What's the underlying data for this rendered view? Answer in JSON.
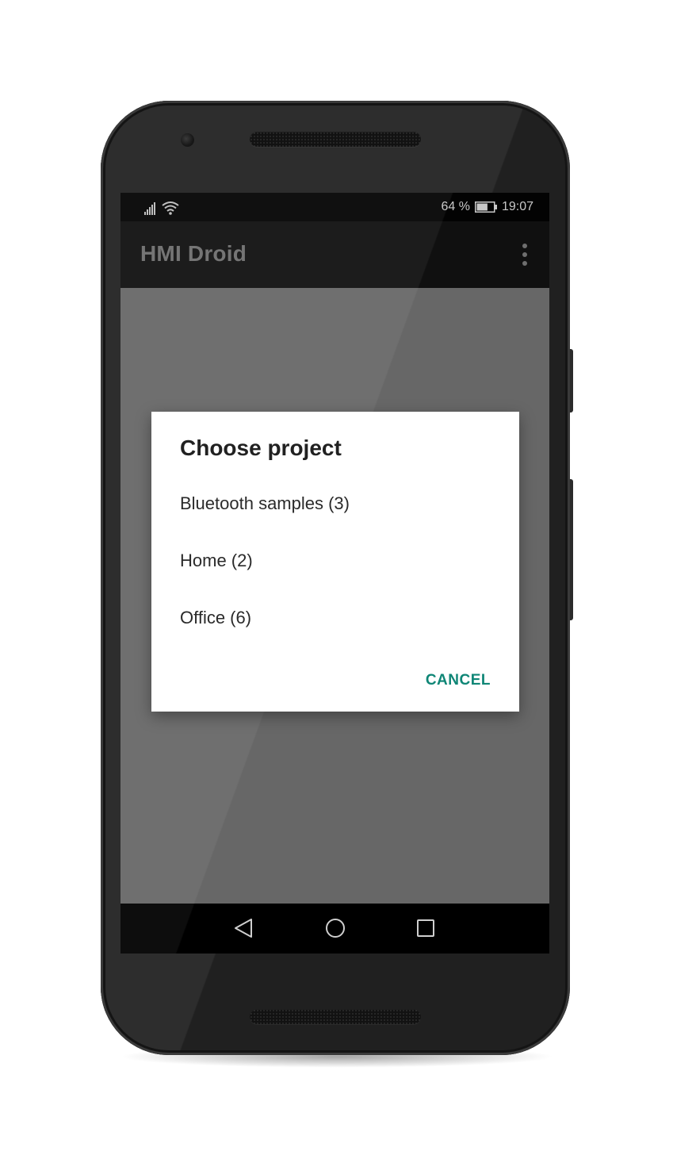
{
  "status_bar": {
    "battery_percent": "64 %",
    "time": "19:07",
    "battery_level": 0.64,
    "icons": [
      "signal-icon",
      "wifi-icon",
      "battery-icon"
    ]
  },
  "app_bar": {
    "title": "HMI Droid",
    "overflow_icon": "more-vert-icon"
  },
  "dialog": {
    "title": "Choose project",
    "items": [
      {
        "label": "Bluetooth samples (3)"
      },
      {
        "label": "Home (2)"
      },
      {
        "label": "Office (6)"
      }
    ],
    "cancel_label": "CANCEL"
  },
  "nav_bar": {
    "icons": [
      "back-icon",
      "home-icon",
      "recents-icon"
    ]
  },
  "colors": {
    "accent": "#0f8676",
    "scrim": "#676767",
    "app_bar": "#101010",
    "status_bar": "#030303"
  }
}
